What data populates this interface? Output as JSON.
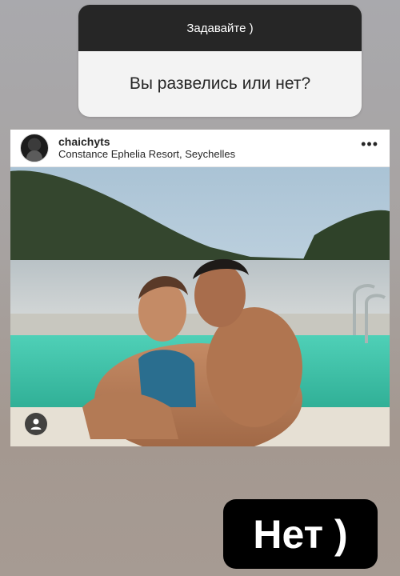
{
  "question_card": {
    "header": "Задавайте )",
    "question": "Вы развелись или нет?"
  },
  "post": {
    "username": "chaichyts",
    "location": "Constance Ephelia Resort, Seychelles",
    "more_icon": "more-options-icon",
    "tag_icon": "user-tag-icon"
  },
  "answer_sticker": {
    "text": "Нет )"
  },
  "colors": {
    "dark": "#262626",
    "pool": "#3fc1a6",
    "sky": "#c9dbe6"
  }
}
